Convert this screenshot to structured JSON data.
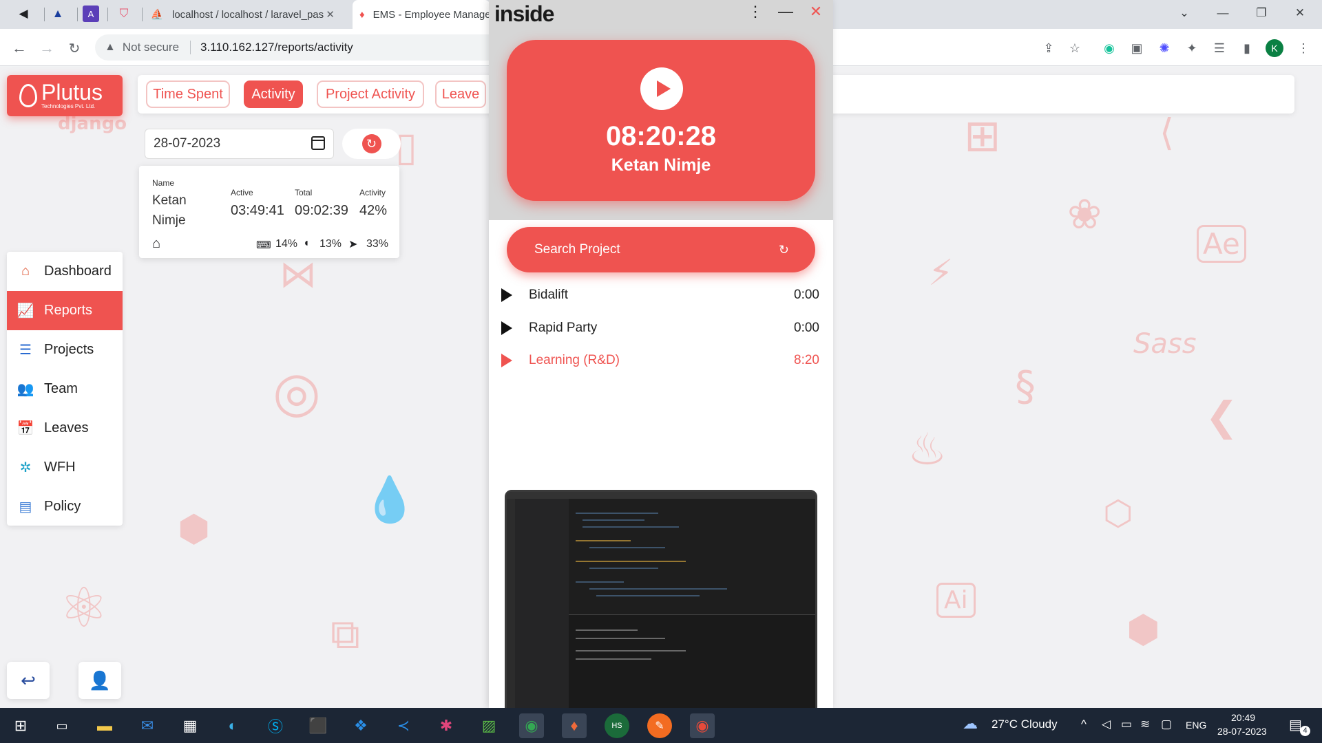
{
  "browser": {
    "tabs": [
      {
        "title": "localhost / localhost / laravel_pas"
      },
      {
        "title": "EMS - Employee Manage"
      }
    ],
    "not_secure": "Not secure",
    "url": "3.110.162.127/reports/activity",
    "profile_initial": "K"
  },
  "app": {
    "logo_name": "Plutus",
    "logo_sub": "Technologies Pvt. Ltd.",
    "nav_tabs": [
      "Time Spent",
      "Activity",
      "Project Activity",
      "Leave"
    ],
    "date_value": "28-07-2023",
    "card": {
      "name_label": "Name",
      "name_first": "Ketan",
      "name_last": "Nimje",
      "active_label": "Active",
      "active_value": "03:49:41",
      "total_label": "Total",
      "total_value": "09:02:39",
      "activity_label": "Activity",
      "activity_value": "42%",
      "keyboard_pct": "14%",
      "mouse_pct": "13%",
      "cursor_pct": "33%"
    },
    "sidebar": [
      {
        "label": "Dashboard",
        "icon": "home-icon"
      },
      {
        "label": "Reports",
        "icon": "chart-icon"
      },
      {
        "label": "Projects",
        "icon": "list-icon"
      },
      {
        "label": "Team",
        "icon": "team-icon"
      },
      {
        "label": "Leaves",
        "icon": "calendar-icon"
      },
      {
        "label": "WFH",
        "icon": "network-icon"
      },
      {
        "label": "Policy",
        "icon": "document-icon"
      }
    ],
    "bg_text": "django"
  },
  "inside": {
    "title": "inside",
    "timer": "08:20:28",
    "user": "Ketan Nimje",
    "search_label": "Search Project",
    "projects": [
      {
        "name": "Bidalift",
        "time": "0:00"
      },
      {
        "name": "Rapid Party",
        "time": "0:00"
      },
      {
        "name": "Learning (R&D)",
        "time": "8:20"
      }
    ]
  },
  "taskbar": {
    "weather": "27°C  Cloudy",
    "lang": "ENG",
    "time": "20:49",
    "date": "28-07-2023",
    "notif_count": "4"
  },
  "colors": {
    "accent": "#ef5350",
    "taskbar": "#1c2635"
  }
}
